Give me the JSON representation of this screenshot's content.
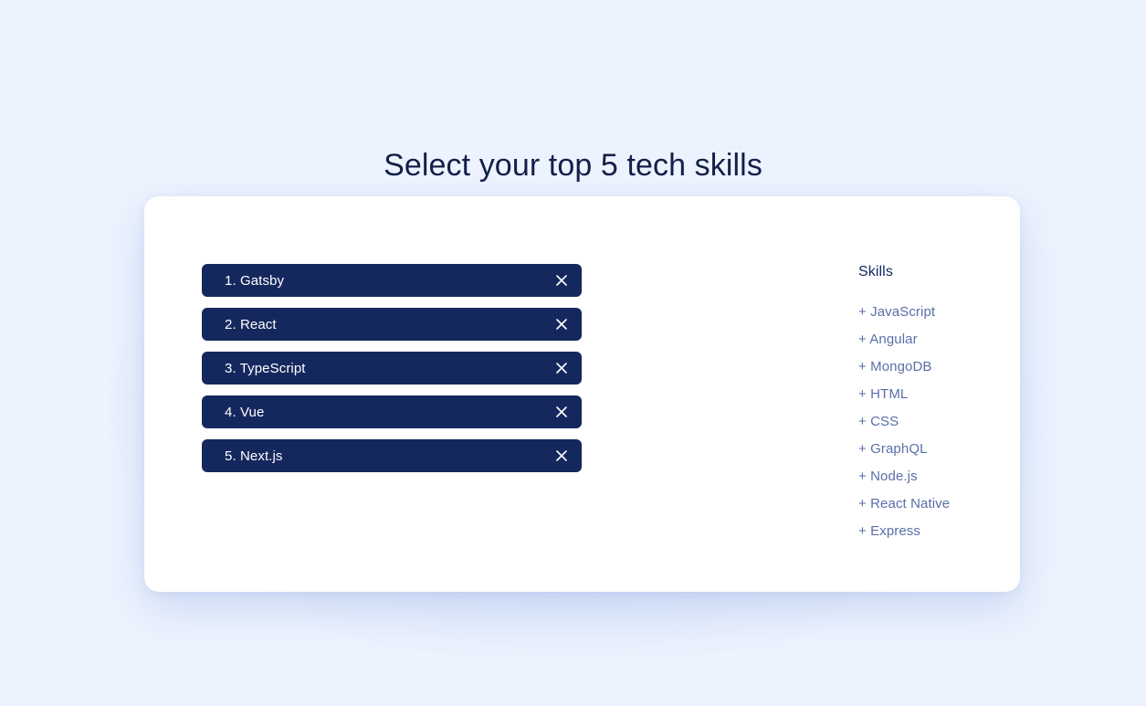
{
  "page": {
    "title": "Select your top 5 tech skills",
    "background_color": "#edf3fe",
    "card_background": "#ffffff",
    "title_color": "#132049"
  },
  "selected": {
    "pill_color": "#15285e",
    "pill_text_color": "#ffffff",
    "remove_icon": "close-icon",
    "items": [
      {
        "label": "1. Gatsby"
      },
      {
        "label": "2. React"
      },
      {
        "label": "3. TypeScript"
      },
      {
        "label": "4. Vue"
      },
      {
        "label": "5. Next.js"
      }
    ]
  },
  "available": {
    "heading": "Skills",
    "heading_color": "#112a60",
    "item_color": "#5a6fa8",
    "items": [
      {
        "label": "+ JavaScript"
      },
      {
        "label": "+ Angular"
      },
      {
        "label": "+ MongoDB"
      },
      {
        "label": "+ HTML"
      },
      {
        "label": "+ CSS"
      },
      {
        "label": "+ GraphQL"
      },
      {
        "label": "+ Node.js"
      },
      {
        "label": "+ React Native"
      },
      {
        "label": "+ Express"
      }
    ]
  }
}
